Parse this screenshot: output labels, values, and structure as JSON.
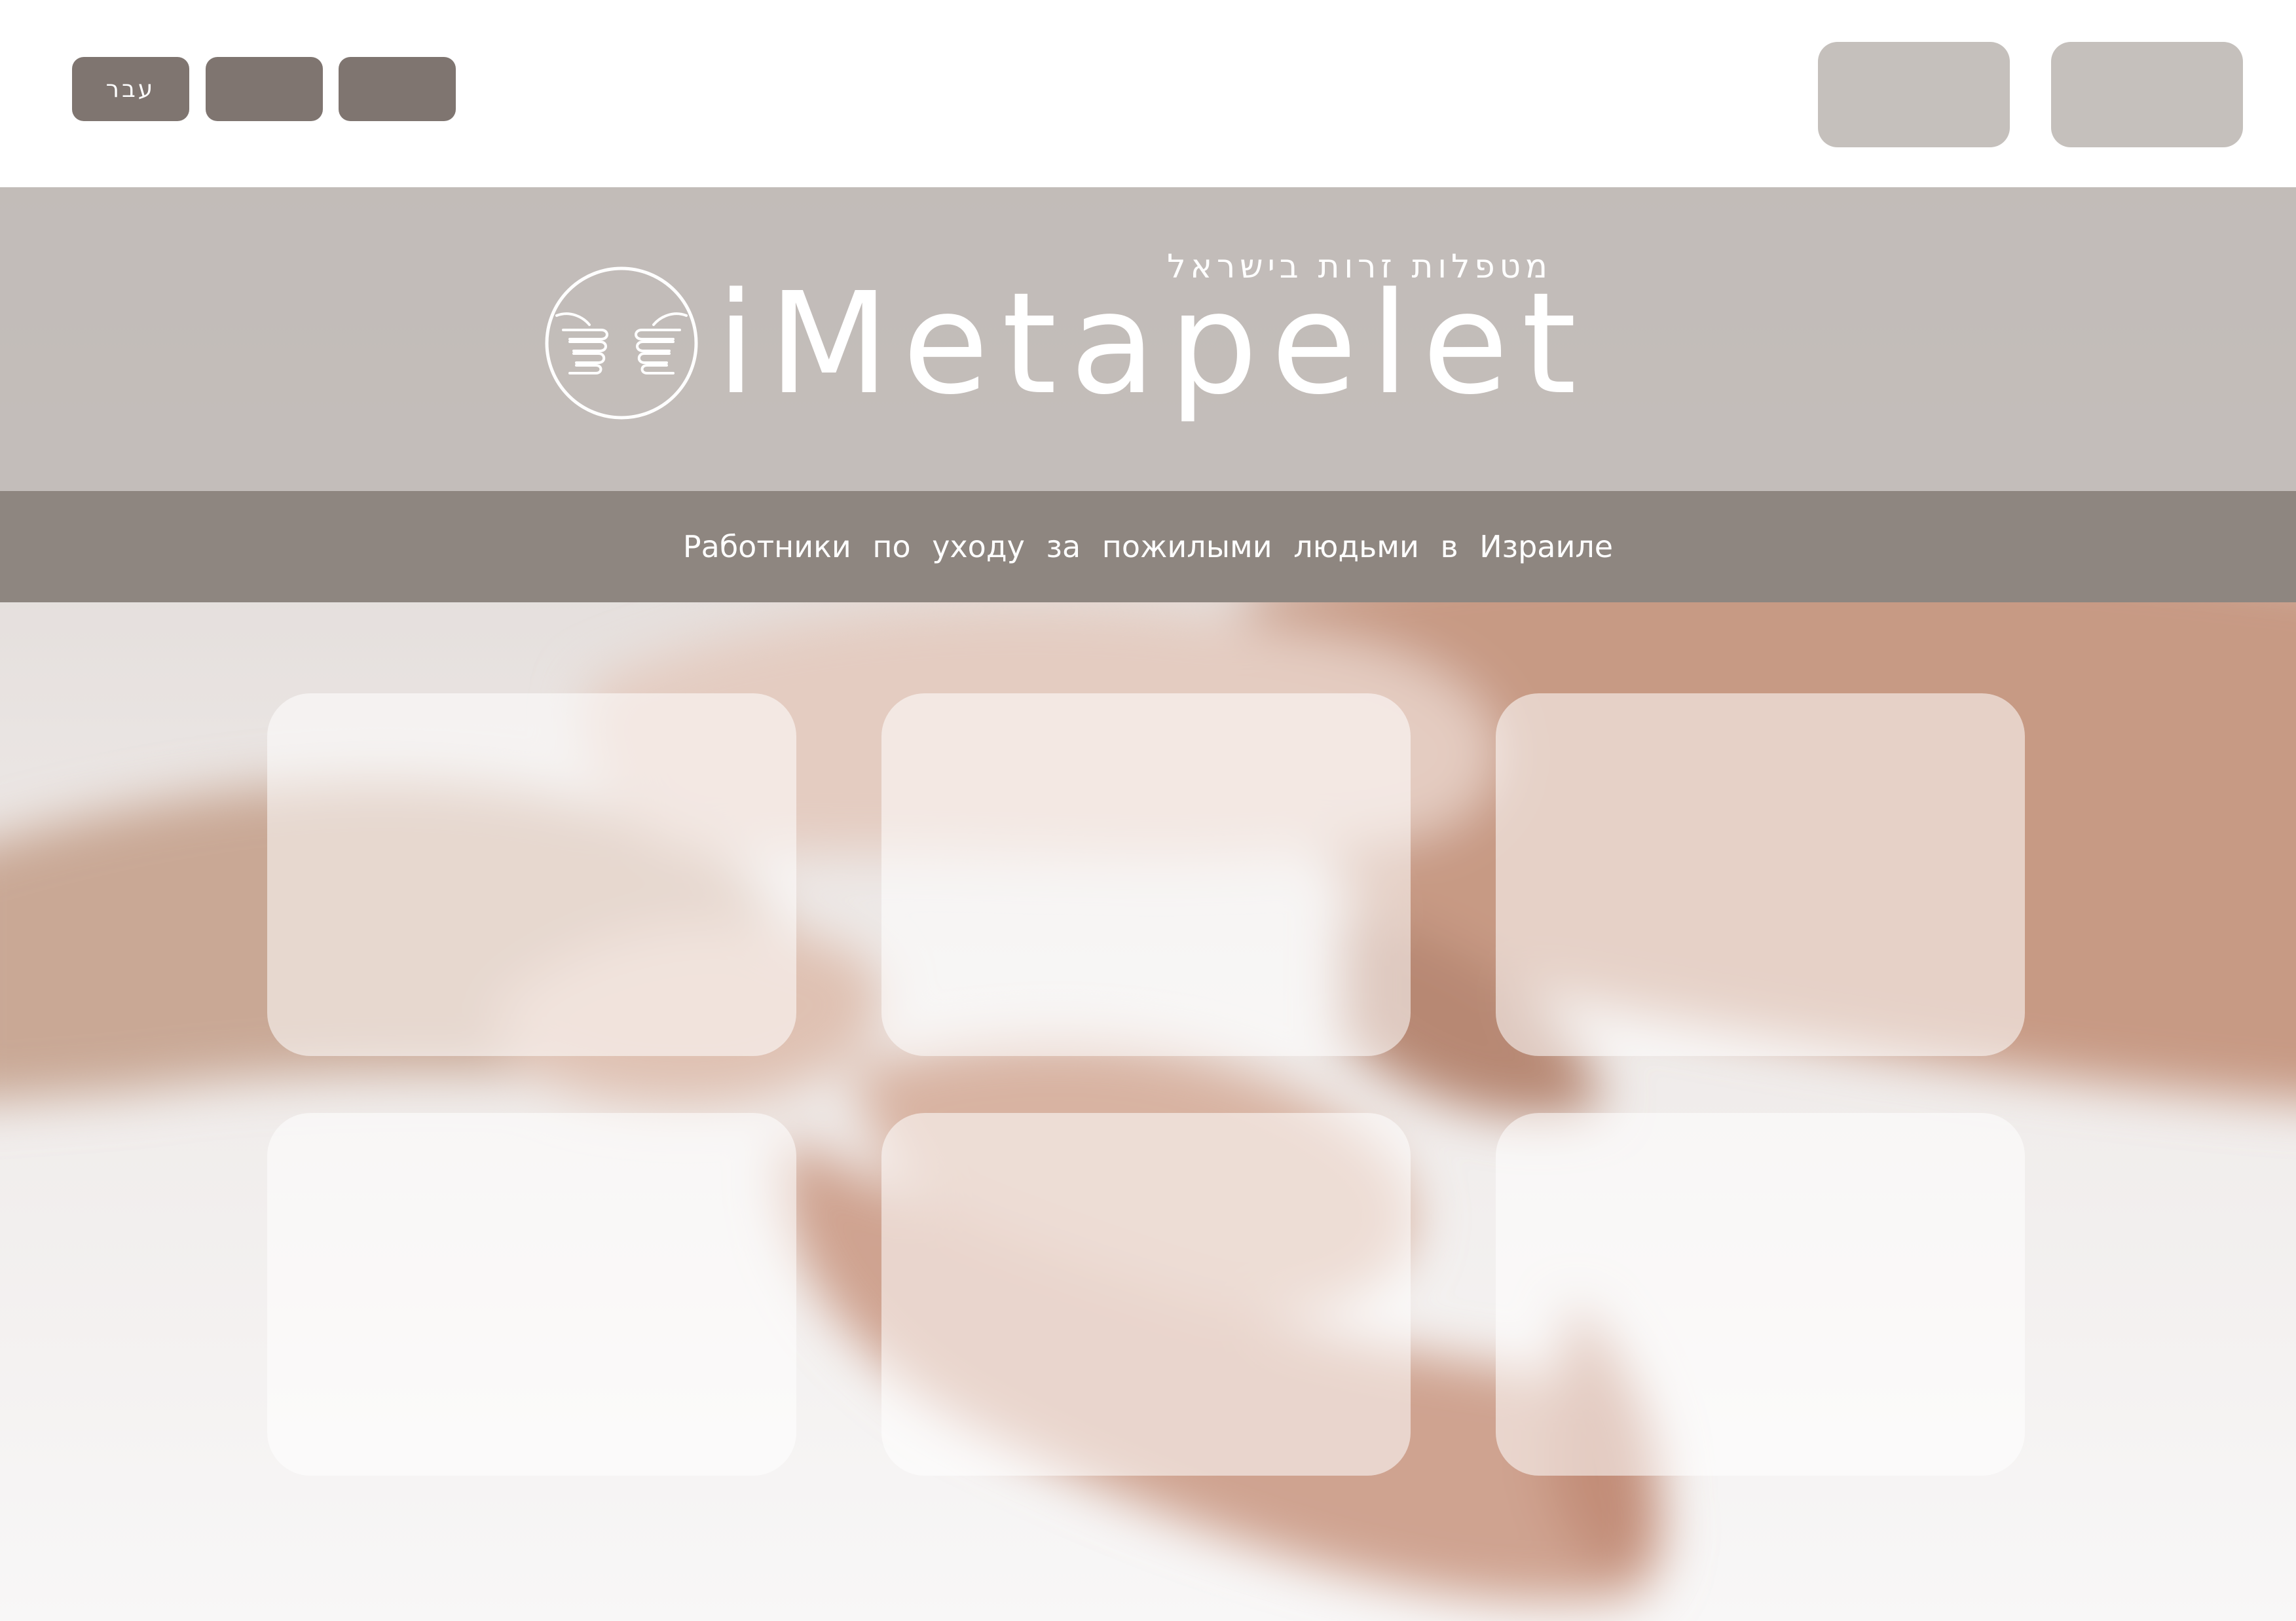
{
  "header": {
    "lang_buttons": [
      {
        "label": "עבר"
      },
      {
        "label": ""
      },
      {
        "label": ""
      }
    ],
    "action_buttons": [
      {
        "label": ""
      },
      {
        "label": ""
      }
    ]
  },
  "hero": {
    "tagline": "מטפלות זרות בישראל",
    "brand": "iMetapelet",
    "subtitle": "Работники по уходу за пожилыми людьми в Израиле",
    "logo_icon": "hands-circle-icon"
  },
  "tiles": [
    {
      "label": ""
    },
    {
      "label": ""
    },
    {
      "label": ""
    },
    {
      "label": ""
    },
    {
      "label": ""
    },
    {
      "label": ""
    }
  ],
  "colors": {
    "dark_button": "#7f7570",
    "light_button": "#c5c0bc",
    "band": "#beb8b4",
    "sub_band": "#8e8680",
    "text": "#ffffff"
  }
}
